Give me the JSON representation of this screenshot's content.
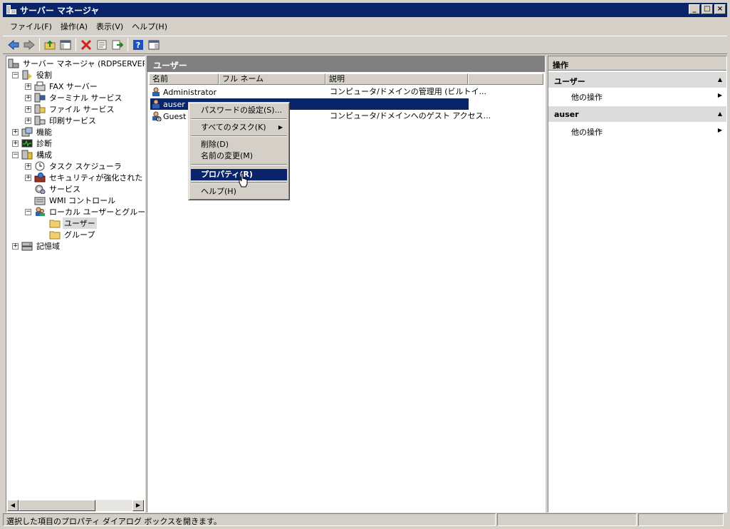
{
  "window": {
    "title": "サーバー マネージャ"
  },
  "menu": [
    "ファイル(F)",
    "操作(A)",
    "表示(V)",
    "ヘルプ(H)"
  ],
  "tree": {
    "root": "サーバー マネージャ (RDPSERVER",
    "roles": "役割",
    "fax": "FAX サーバー",
    "terminal": "ターミナル サービス",
    "file": "ファイル サービス",
    "print": "印刷サービス",
    "features": "機能",
    "diagnostics": "診断",
    "configuration": "構成",
    "task_scheduler": "タスク スケジューラ",
    "firewall": "セキュリティが強化された Wi",
    "services": "サービス",
    "wmi": "WMI コントロール",
    "local_users": "ローカル ユーザーとグループ",
    "users": "ユーザー",
    "groups": "グループ",
    "storage": "記憶域"
  },
  "center": {
    "title": "ユーザー",
    "columns": [
      "名前",
      "フル ネーム",
      "説明"
    ],
    "rows": [
      {
        "name": "Administrator",
        "fullname": "",
        "description": "コンピュータ/ドメインの管理用 (ビルトイ..."
      },
      {
        "name": "auser",
        "fullname": "",
        "description": ""
      },
      {
        "name": "Guest",
        "fullname": "",
        "description": "コンピュータ/ドメインへのゲスト アクセス..."
      }
    ]
  },
  "context_menu": {
    "set_password": "パスワードの設定(S)...",
    "all_tasks": "すべてのタスク(K)",
    "delete": "削除(D)",
    "rename": "名前の変更(M)",
    "properties": "プロパティ(R)",
    "help": "ヘルプ(H)"
  },
  "actions": {
    "title": "操作",
    "section1": "ユーザー",
    "section1_item": "他の操作",
    "section2": "auser",
    "section2_item": "他の操作"
  },
  "status": {
    "text": "選択した項目のプロパティ ダイアログ ボックスを開きます。"
  }
}
